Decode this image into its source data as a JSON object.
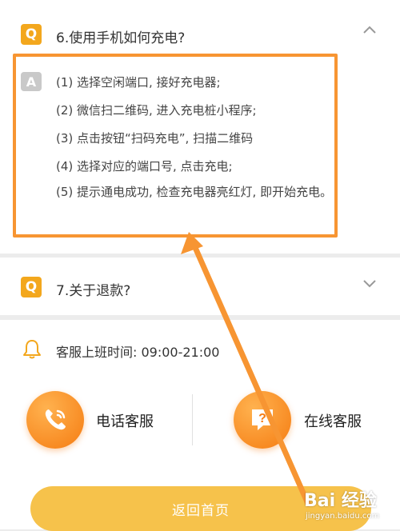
{
  "faq": {
    "q6": {
      "badge": "Q",
      "title": "6.使用手机如何充电?",
      "answer_badge": "A",
      "steps": [
        "(1) 选择空闲端口, 接好充电器;",
        "(2) 微信扫二维码, 进入充电桩小程序;",
        "(3) 点击按钮“扫码充电”, 扫描二维码",
        "(4) 选择对应的端口号, 点击充电;",
        "(5) 提示通电成功, 检查充电器亮红灯, 即开始充电。"
      ]
    },
    "q7": {
      "badge": "Q",
      "title": "7.关于退款?"
    }
  },
  "service": {
    "hours": "客服上班时间: 09:00-21:00",
    "phone_label": "电话客服",
    "online_label": "在线客服",
    "online_icon_glyph": "?"
  },
  "home_button": "返回首页",
  "watermark": {
    "main": "Bai 经验",
    "sub": "jingyan.baidu.com"
  },
  "colors": {
    "accent": "#f3a71d",
    "highlight": "#f79532",
    "button": "#f6c24b"
  }
}
